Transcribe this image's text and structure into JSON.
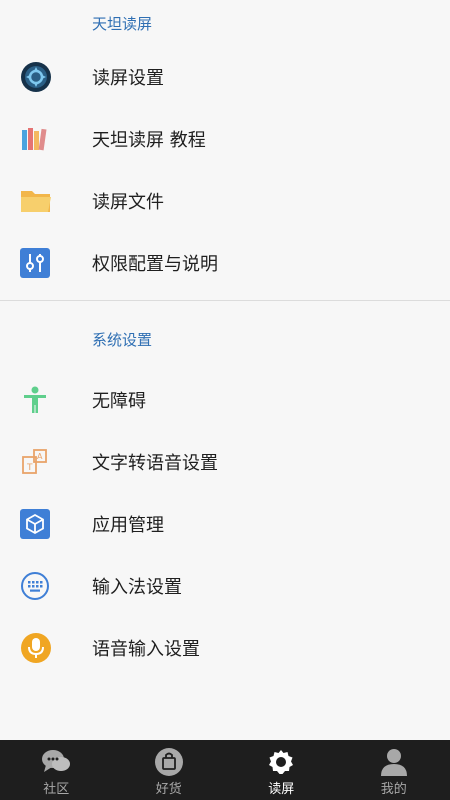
{
  "sections": [
    {
      "title": "天坦读屏",
      "items": [
        {
          "label": "读屏设置",
          "icon": "gear-icon"
        },
        {
          "label": "天坦读屏 教程",
          "icon": "books-icon"
        },
        {
          "label": "读屏文件",
          "icon": "folder-icon"
        },
        {
          "label": "权限配置与说明",
          "icon": "sliders-icon"
        }
      ]
    },
    {
      "title": "系统设置",
      "items": [
        {
          "label": "无障碍",
          "icon": "accessibility-icon"
        },
        {
          "label": "文字转语音设置",
          "icon": "text-to-speech-icon"
        },
        {
          "label": "应用管理",
          "icon": "app-cube-icon"
        },
        {
          "label": "输入法设置",
          "icon": "keyboard-icon"
        },
        {
          "label": "语音输入设置",
          "icon": "microphone-icon"
        }
      ]
    }
  ],
  "bottom_nav": [
    {
      "label": "社区",
      "icon": "chat-bubbles-icon",
      "active": false
    },
    {
      "label": "好货",
      "icon": "shopping-bag-icon",
      "active": false
    },
    {
      "label": "读屏",
      "icon": "gear-icon",
      "active": true
    },
    {
      "label": "我的",
      "icon": "person-icon",
      "active": false
    }
  ],
  "colors": {
    "section_title": "#2f6fb3",
    "nav_bg": "#1e1e1e",
    "nav_active": "#ffffff",
    "nav_inactive": "#a8a8a8"
  }
}
